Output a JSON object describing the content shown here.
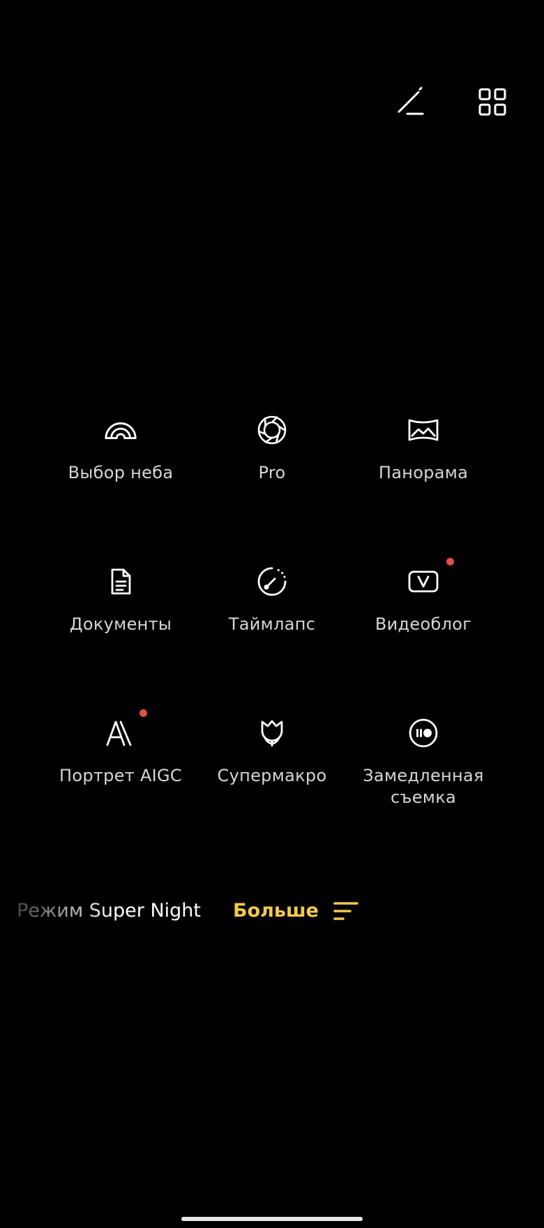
{
  "top_bar": {
    "edit_icon": "edit-pen-icon",
    "grid_icon": "grid-layout-icon"
  },
  "modes": [
    {
      "label": "Выбор неба",
      "icon": "rainbow-icon",
      "badge": false
    },
    {
      "label": "Pro",
      "icon": "aperture-icon",
      "badge": false
    },
    {
      "label": "Панорама",
      "icon": "panorama-icon",
      "badge": false
    },
    {
      "label": "Документы",
      "icon": "document-icon",
      "badge": false
    },
    {
      "label": "Таймлапс",
      "icon": "timelapse-icon",
      "badge": false
    },
    {
      "label": "Видеоблог",
      "icon": "vlog-icon",
      "badge": true
    },
    {
      "label": "Портрет AIGC",
      "icon": "aigc-icon",
      "badge": true
    },
    {
      "label": "Супермакро",
      "icon": "tulip-icon",
      "badge": false
    },
    {
      "label": "Замедленная съемка",
      "icon": "slow-motion-icon",
      "badge": false
    }
  ],
  "mode_strip": {
    "current_mode": "Режим Super Night",
    "more_label": "Больше",
    "more_icon": "menu-lines-icon"
  },
  "colors": {
    "background": "#000000",
    "accent": "#f2c94c",
    "badge": "#e0504a"
  }
}
